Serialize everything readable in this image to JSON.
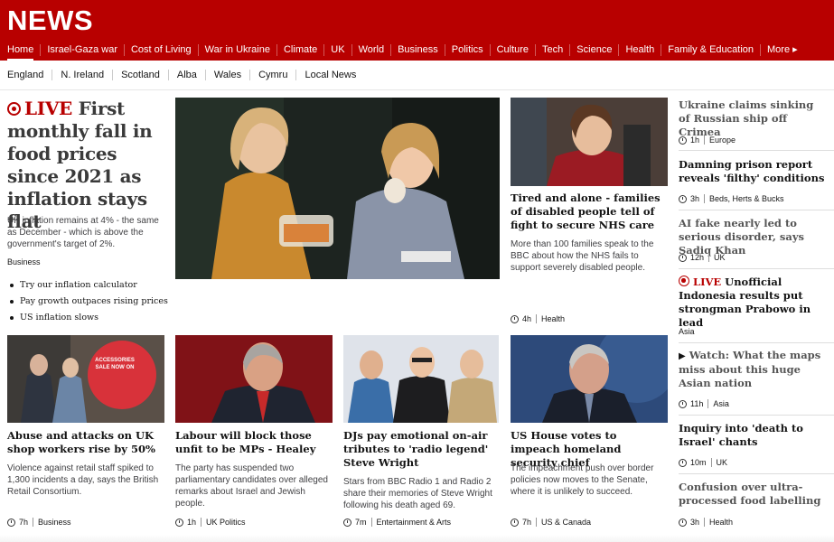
{
  "brand": {
    "logo": "NEWS",
    "bg": "#b80000"
  },
  "nav": {
    "items": [
      "Home",
      "Israel-Gaza war",
      "Cost of Living",
      "War in Ukraine",
      "Climate",
      "UK",
      "World",
      "Business",
      "Politics",
      "Culture",
      "Tech",
      "Science",
      "Health",
      "Family & Education",
      "More ▸"
    ]
  },
  "subnav": {
    "items": [
      "England",
      "N. Ireland",
      "Scotland",
      "Alba",
      "Wales",
      "Cymru",
      "Local News"
    ]
  },
  "lead": {
    "live": "LIVE",
    "headline": "First monthly fall in food prices since 2021 as inflation stays flat",
    "summary": "UK inflation remains at 4% - the same as December - which is above the government's target of 2%.",
    "tag": "Business",
    "bullets": [
      "Try our inflation calculator",
      "Pay growth outpaces rising prices",
      "US inflation slows"
    ]
  },
  "feature": {
    "title": "Tired and alone - families of disabled people tell of fight to secure NHS care",
    "summary": "More than 100 families speak to the BBC about how the NHS fails to support severely disabled people.",
    "time": "4h",
    "tag": "Health"
  },
  "right": [
    {
      "title": "Ukraine claims sinking of Russian ship off Crimea",
      "time": "1h",
      "tag": "Europe"
    },
    {
      "title": "Damning prison report reveals 'filthy' conditions",
      "time": "3h",
      "tag": "Beds, Herts & Bucks"
    },
    {
      "title": "AI fake nearly led to serious disorder, says Sadiq Khan",
      "time": "12h",
      "tag": "UK"
    },
    {
      "live": "LIVE",
      "title": "Unofficial Indonesia results put strongman Prabowo in lead",
      "tag": "Asia"
    },
    {
      "prefix": "▶",
      "title": "Watch: What the maps miss about this huge Asian nation",
      "time": "11h",
      "tag": "Asia"
    },
    {
      "title": "Inquiry into 'death to Israel' chants",
      "time": "10m",
      "tag": "UK"
    },
    {
      "title": "Confusion over ultra-processed food labelling",
      "time": "3h",
      "tag": "Health"
    }
  ],
  "cards": [
    {
      "title": "Abuse and attacks on UK shop workers rise by 50%",
      "summary": "Violence against retail staff spiked to 1,300 incidents a day, says the British Retail Consortium.",
      "time": "7h",
      "tag": "Business",
      "sign": "ACCESSORIES SALE NOW ON"
    },
    {
      "title": "Labour will block those unfit to be MPs - Healey",
      "summary": "The party has suspended two parliamentary candidates over alleged remarks about Israel and Jewish people.",
      "time": "1h",
      "tag": "UK Politics"
    },
    {
      "title": "DJs pay emotional on-air tributes to 'radio legend' Steve Wright",
      "summary": "Stars from BBC Radio 1 and Radio 2 share their memories of Steve Wright following his death aged 69.",
      "time": "7m",
      "tag": "Entertainment & Arts"
    },
    {
      "title": "US House votes to impeach homeland security chief",
      "summary": "The impeachment push over border policies now moves to the Senate, where it is unlikely to succeed.",
      "time": "7h",
      "tag": "US & Canada"
    }
  ]
}
